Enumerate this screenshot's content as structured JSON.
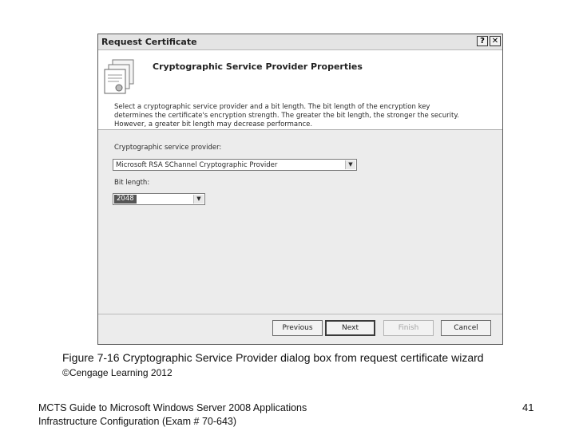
{
  "dialog": {
    "title": "Request Certificate",
    "help_glyph": "?",
    "close_glyph": "✕",
    "header_title": "Cryptographic Service Provider Properties",
    "description": "Select a cryptographic service provider and a bit length. The bit length of the encryption key determines the certificate's encryption strength. The greater the bit length, the stronger the security. However, a greater bit length may decrease performance.",
    "csp_label": "Cryptographic service provider:",
    "csp_value": "Microsoft RSA SChannel Cryptographic Provider",
    "bit_length_label": "Bit length:",
    "bit_length_value": "2048",
    "buttons": {
      "previous": "Previous",
      "next": "Next",
      "finish": "Finish",
      "cancel": "Cancel"
    }
  },
  "slide": {
    "caption": "Figure 7-16 Cryptographic Service Provider dialog box from request certificate wizard",
    "copyright": "©Cengage Learning 2012",
    "footer_line1": "MCTS Guide to Microsoft Windows Server 2008 Applications",
    "footer_line2": "Infrastructure Configuration (Exam # 70-643)",
    "page_number": "41"
  }
}
